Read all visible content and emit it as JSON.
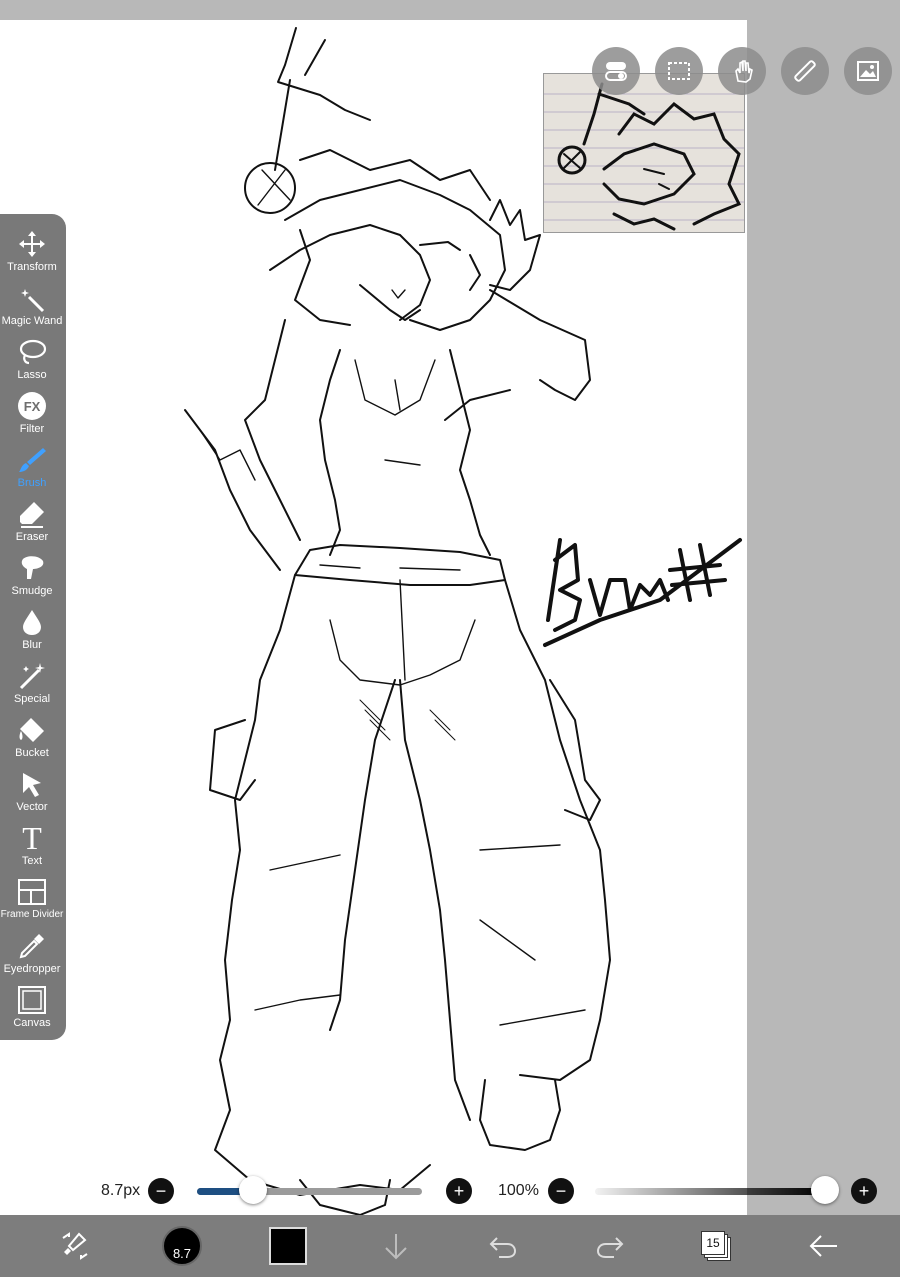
{
  "toolbar": {
    "tools": [
      {
        "label": "Transform",
        "icon": "move-arrows-icon"
      },
      {
        "label": "Magic Wand",
        "icon": "magic-wand-icon"
      },
      {
        "label": "Lasso",
        "icon": "lasso-icon"
      },
      {
        "label": "Filter",
        "icon": "fx-icon"
      },
      {
        "label": "Brush",
        "icon": "brush-icon"
      },
      {
        "label": "Eraser",
        "icon": "eraser-icon"
      },
      {
        "label": "Smudge",
        "icon": "smudge-icon"
      },
      {
        "label": "Blur",
        "icon": "blur-drop-icon"
      },
      {
        "label": "Special",
        "icon": "special-icon"
      },
      {
        "label": "Bucket",
        "icon": "bucket-icon"
      },
      {
        "label": "Vector",
        "icon": "vector-arrow-icon"
      },
      {
        "label": "Text",
        "icon": "text-icon"
      },
      {
        "label": "Frame Divider",
        "icon": "frame-divider-icon"
      },
      {
        "label": "Eyedropper",
        "icon": "eyedropper-icon"
      },
      {
        "label": "Canvas",
        "icon": "canvas-icon"
      }
    ],
    "active": "Brush",
    "filter_glyph": "FX",
    "text_glyph": "T"
  },
  "sliders": {
    "size_label": "8.7px",
    "size_value": 0.25,
    "zoom_label": "100%",
    "opacity_value": 1.0,
    "minus": "−",
    "plus": "+"
  },
  "bottom": {
    "brush_size": "8.7",
    "layer_count": "15",
    "primary_color": "#000000"
  },
  "colors": {
    "accent": "#3fa0ff",
    "slider_fill": "#1e4f82"
  }
}
